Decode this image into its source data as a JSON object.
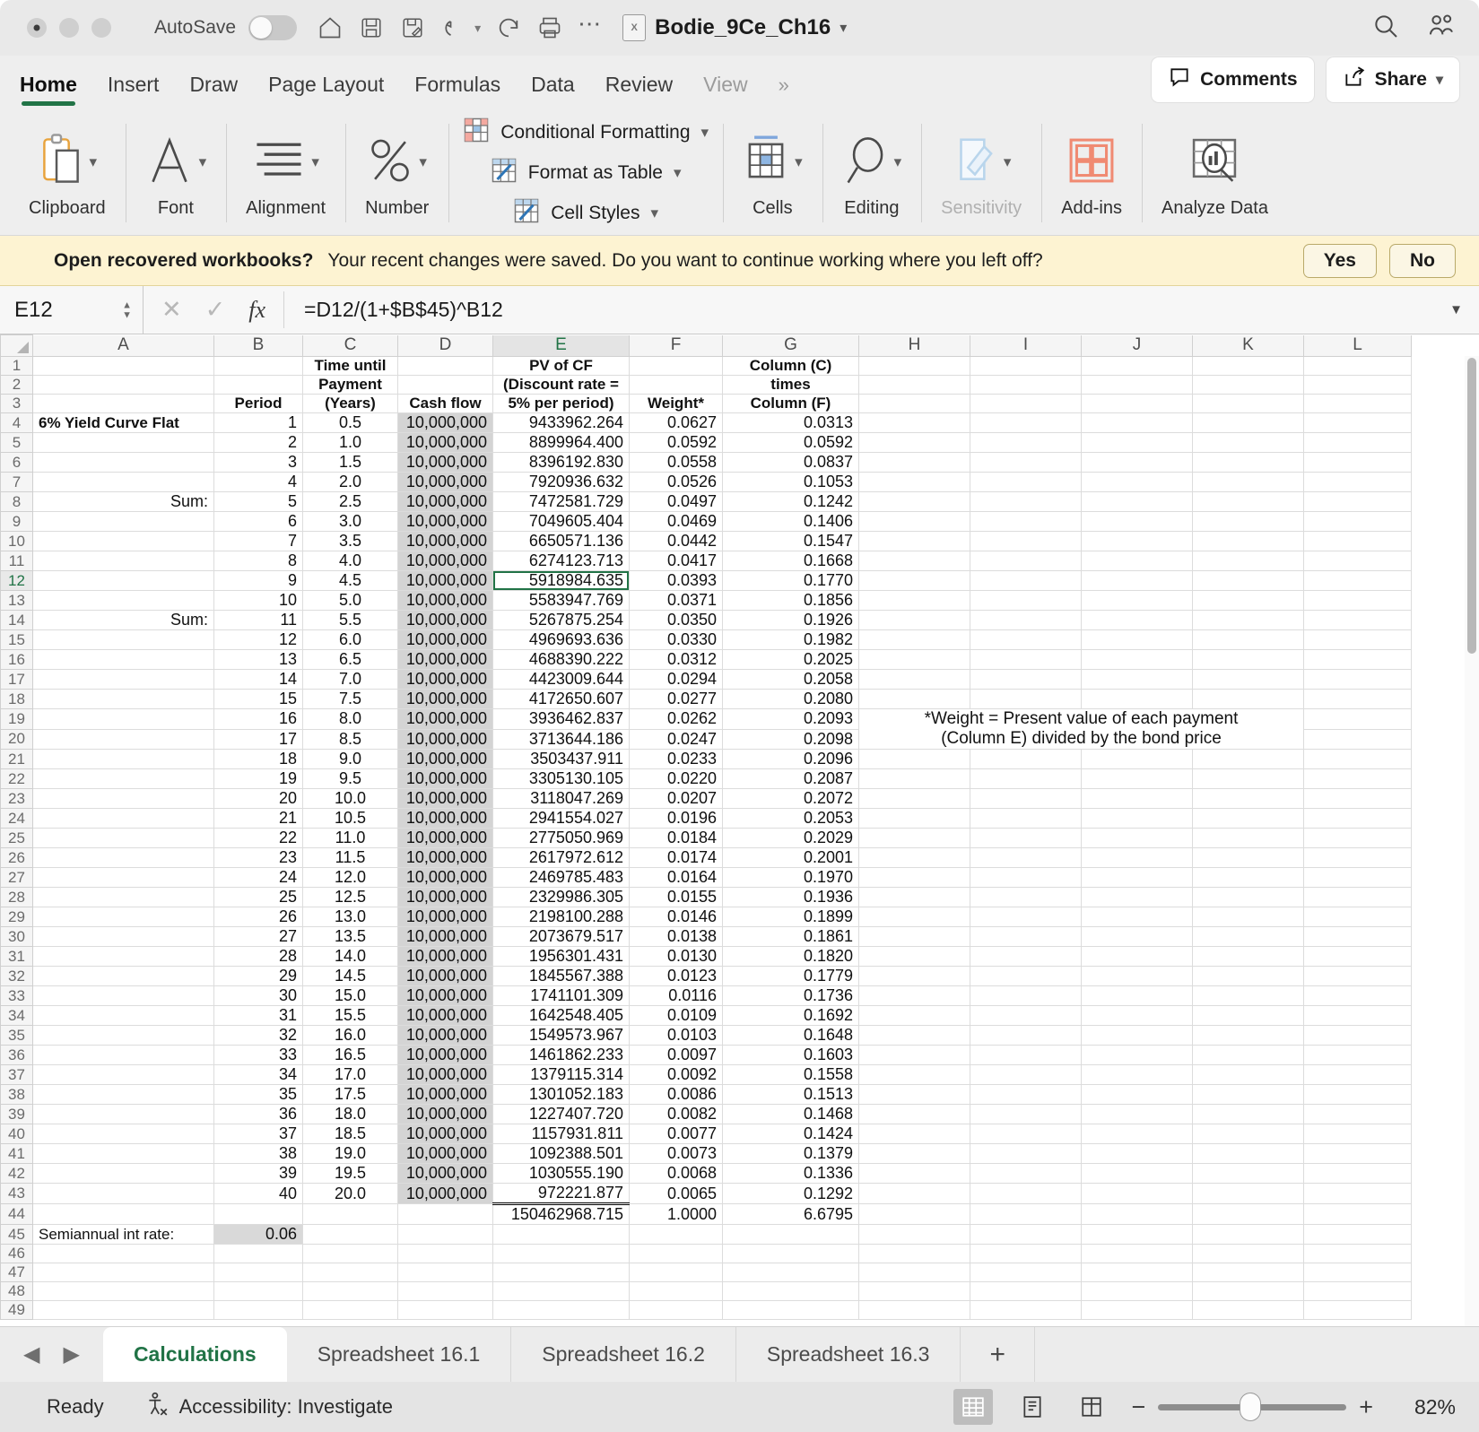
{
  "titlebar": {
    "autosave_label": "AutoSave",
    "autosave_state": "off",
    "doc_title": "Bodie_9Ce_Ch16",
    "icons": [
      "home-icon",
      "save-icon",
      "save-as-icon",
      "undo-icon",
      "redo-icon",
      "print-icon",
      "more-icon",
      "search-icon",
      "user-group-icon"
    ]
  },
  "ribbon_tabs": {
    "tabs": [
      "Home",
      "Insert",
      "Draw",
      "Page Layout",
      "Formulas",
      "Data",
      "Review",
      "View"
    ],
    "active": "Home",
    "overflow": "»",
    "comments_label": "Comments",
    "share_label": "Share"
  },
  "ribbon": {
    "groups": [
      {
        "label": "Clipboard",
        "icon": "clipboard-icon"
      },
      {
        "label": "Font",
        "icon": "font-icon"
      },
      {
        "label": "Alignment",
        "icon": "alignment-icon"
      },
      {
        "label": "Number",
        "icon": "percent-icon"
      }
    ],
    "styles_items": [
      {
        "label": "Conditional Formatting",
        "icon": "conditional-formatting-icon"
      },
      {
        "label": "Format as Table",
        "icon": "format-as-table-icon"
      },
      {
        "label": "Cell Styles",
        "icon": "cell-styles-icon"
      }
    ],
    "right_groups": [
      {
        "label": "Cells",
        "icon": "cells-icon",
        "dim": false
      },
      {
        "label": "Editing",
        "icon": "editing-icon",
        "dim": false
      },
      {
        "label": "Sensitivity",
        "icon": "sensitivity-icon",
        "dim": true
      },
      {
        "label": "Add-ins",
        "icon": "add-ins-icon",
        "dim": false
      },
      {
        "label": "Analyze Data",
        "icon": "analyze-data-icon",
        "dim": false
      }
    ]
  },
  "recovery_bar": {
    "title": "Open recovered workbooks?",
    "message": "Your recent changes were saved. Do you want to continue working where you left off?",
    "yes_label": "Yes",
    "no_label": "No"
  },
  "formula_bar": {
    "name_box": "E12",
    "cancel_icon": "cancel-icon",
    "confirm_icon": "confirm-icon",
    "fx_label": "fx",
    "formula": "=D12/(1+$B$45)^B12",
    "expand_icon": "chevron-down-icon"
  },
  "grid": {
    "column_headers": [
      "A",
      "B",
      "C",
      "D",
      "E",
      "F",
      "G",
      "H",
      "I",
      "J",
      "K",
      "L"
    ],
    "selected_column": "E",
    "selected_row": 12,
    "header_rows": [
      {
        "row": 1,
        "A": "",
        "B": "",
        "C": "Time until",
        "D": "",
        "E": "PV of CF",
        "F": "",
        "G": "Column (C)"
      },
      {
        "row": 2,
        "A": "",
        "B": "",
        "C": "Payment",
        "D": "",
        "E": "(Discount rate =",
        "F": "",
        "G": "times"
      },
      {
        "row": 3,
        "A": "",
        "B": "Period",
        "C": "(Years)",
        "D": "Cash flow",
        "E": "5% per period)",
        "F": "Weight*",
        "G": "Column (F)"
      }
    ],
    "label_cells": {
      "a4": "6% Yield Curve Flat",
      "b8_sum": "Sum:",
      "b14_sum": "Sum:",
      "a45": "Semiannual int rate:",
      "b45": "0.06"
    },
    "note": {
      "line1": "*Weight = Present value of each payment",
      "line2": "(Column E) divided by the bond price",
      "row_start": 19
    },
    "rows": [
      {
        "row": 4,
        "period": "1",
        "years": "0.5",
        "cash": "10,000,000",
        "pv": "9433962.264",
        "weight": "0.0627",
        "cf": "0.0313"
      },
      {
        "row": 5,
        "period": "2",
        "years": "1.0",
        "cash": "10,000,000",
        "pv": "8899964.400",
        "weight": "0.0592",
        "cf": "0.0592"
      },
      {
        "row": 6,
        "period": "3",
        "years": "1.5",
        "cash": "10,000,000",
        "pv": "8396192.830",
        "weight": "0.0558",
        "cf": "0.0837"
      },
      {
        "row": 7,
        "period": "4",
        "years": "2.0",
        "cash": "10,000,000",
        "pv": "7920936.632",
        "weight": "0.0526",
        "cf": "0.1053"
      },
      {
        "row": 8,
        "period": "5",
        "years": "2.5",
        "cash": "10,000,000",
        "pv": "7472581.729",
        "weight": "0.0497",
        "cf": "0.1242"
      },
      {
        "row": 9,
        "period": "6",
        "years": "3.0",
        "cash": "10,000,000",
        "pv": "7049605.404",
        "weight": "0.0469",
        "cf": "0.1406"
      },
      {
        "row": 10,
        "period": "7",
        "years": "3.5",
        "cash": "10,000,000",
        "pv": "6650571.136",
        "weight": "0.0442",
        "cf": "0.1547"
      },
      {
        "row": 11,
        "period": "8",
        "years": "4.0",
        "cash": "10,000,000",
        "pv": "6274123.713",
        "weight": "0.0417",
        "cf": "0.1668"
      },
      {
        "row": 12,
        "period": "9",
        "years": "4.5",
        "cash": "10,000,000",
        "pv": "5918984.635",
        "weight": "0.0393",
        "cf": "0.1770"
      },
      {
        "row": 13,
        "period": "10",
        "years": "5.0",
        "cash": "10,000,000",
        "pv": "5583947.769",
        "weight": "0.0371",
        "cf": "0.1856"
      },
      {
        "row": 14,
        "period": "11",
        "years": "5.5",
        "cash": "10,000,000",
        "pv": "5267875.254",
        "weight": "0.0350",
        "cf": "0.1926"
      },
      {
        "row": 15,
        "period": "12",
        "years": "6.0",
        "cash": "10,000,000",
        "pv": "4969693.636",
        "weight": "0.0330",
        "cf": "0.1982"
      },
      {
        "row": 16,
        "period": "13",
        "years": "6.5",
        "cash": "10,000,000",
        "pv": "4688390.222",
        "weight": "0.0312",
        "cf": "0.2025"
      },
      {
        "row": 17,
        "period": "14",
        "years": "7.0",
        "cash": "10,000,000",
        "pv": "4423009.644",
        "weight": "0.0294",
        "cf": "0.2058"
      },
      {
        "row": 18,
        "period": "15",
        "years": "7.5",
        "cash": "10,000,000",
        "pv": "4172650.607",
        "weight": "0.0277",
        "cf": "0.2080"
      },
      {
        "row": 19,
        "period": "16",
        "years": "8.0",
        "cash": "10,000,000",
        "pv": "3936462.837",
        "weight": "0.0262",
        "cf": "0.2093"
      },
      {
        "row": 20,
        "period": "17",
        "years": "8.5",
        "cash": "10,000,000",
        "pv": "3713644.186",
        "weight": "0.0247",
        "cf": "0.2098"
      },
      {
        "row": 21,
        "period": "18",
        "years": "9.0",
        "cash": "10,000,000",
        "pv": "3503437.911",
        "weight": "0.0233",
        "cf": "0.2096"
      },
      {
        "row": 22,
        "period": "19",
        "years": "9.5",
        "cash": "10,000,000",
        "pv": "3305130.105",
        "weight": "0.0220",
        "cf": "0.2087"
      },
      {
        "row": 23,
        "period": "20",
        "years": "10.0",
        "cash": "10,000,000",
        "pv": "3118047.269",
        "weight": "0.0207",
        "cf": "0.2072"
      },
      {
        "row": 24,
        "period": "21",
        "years": "10.5",
        "cash": "10,000,000",
        "pv": "2941554.027",
        "weight": "0.0196",
        "cf": "0.2053"
      },
      {
        "row": 25,
        "period": "22",
        "years": "11.0",
        "cash": "10,000,000",
        "pv": "2775050.969",
        "weight": "0.0184",
        "cf": "0.2029"
      },
      {
        "row": 26,
        "period": "23",
        "years": "11.5",
        "cash": "10,000,000",
        "pv": "2617972.612",
        "weight": "0.0174",
        "cf": "0.2001"
      },
      {
        "row": 27,
        "period": "24",
        "years": "12.0",
        "cash": "10,000,000",
        "pv": "2469785.483",
        "weight": "0.0164",
        "cf": "0.1970"
      },
      {
        "row": 28,
        "period": "25",
        "years": "12.5",
        "cash": "10,000,000",
        "pv": "2329986.305",
        "weight": "0.0155",
        "cf": "0.1936"
      },
      {
        "row": 29,
        "period": "26",
        "years": "13.0",
        "cash": "10,000,000",
        "pv": "2198100.288",
        "weight": "0.0146",
        "cf": "0.1899"
      },
      {
        "row": 30,
        "period": "27",
        "years": "13.5",
        "cash": "10,000,000",
        "pv": "2073679.517",
        "weight": "0.0138",
        "cf": "0.1861"
      },
      {
        "row": 31,
        "period": "28",
        "years": "14.0",
        "cash": "10,000,000",
        "pv": "1956301.431",
        "weight": "0.0130",
        "cf": "0.1820"
      },
      {
        "row": 32,
        "period": "29",
        "years": "14.5",
        "cash": "10,000,000",
        "pv": "1845567.388",
        "weight": "0.0123",
        "cf": "0.1779"
      },
      {
        "row": 33,
        "period": "30",
        "years": "15.0",
        "cash": "10,000,000",
        "pv": "1741101.309",
        "weight": "0.0116",
        "cf": "0.1736"
      },
      {
        "row": 34,
        "period": "31",
        "years": "15.5",
        "cash": "10,000,000",
        "pv": "1642548.405",
        "weight": "0.0109",
        "cf": "0.1692"
      },
      {
        "row": 35,
        "period": "32",
        "years": "16.0",
        "cash": "10,000,000",
        "pv": "1549573.967",
        "weight": "0.0103",
        "cf": "0.1648"
      },
      {
        "row": 36,
        "period": "33",
        "years": "16.5",
        "cash": "10,000,000",
        "pv": "1461862.233",
        "weight": "0.0097",
        "cf": "0.1603"
      },
      {
        "row": 37,
        "period": "34",
        "years": "17.0",
        "cash": "10,000,000",
        "pv": "1379115.314",
        "weight": "0.0092",
        "cf": "0.1558"
      },
      {
        "row": 38,
        "period": "35",
        "years": "17.5",
        "cash": "10,000,000",
        "pv": "1301052.183",
        "weight": "0.0086",
        "cf": "0.1513"
      },
      {
        "row": 39,
        "period": "36",
        "years": "18.0",
        "cash": "10,000,000",
        "pv": "1227407.720",
        "weight": "0.0082",
        "cf": "0.1468"
      },
      {
        "row": 40,
        "period": "37",
        "years": "18.5",
        "cash": "10,000,000",
        "pv": "1157931.811",
        "weight": "0.0077",
        "cf": "0.1424"
      },
      {
        "row": 41,
        "period": "38",
        "years": "19.0",
        "cash": "10,000,000",
        "pv": "1092388.501",
        "weight": "0.0073",
        "cf": "0.1379"
      },
      {
        "row": 42,
        "period": "39",
        "years": "19.5",
        "cash": "10,000,000",
        "pv": "1030555.190",
        "weight": "0.0068",
        "cf": "0.1336"
      },
      {
        "row": 43,
        "period": "40",
        "years": "20.0",
        "cash": "10,000,000",
        "pv": "972221.877",
        "weight": "0.0065",
        "cf": "0.1292"
      },
      {
        "row": 44,
        "period": "",
        "years": "",
        "cash": "",
        "pv": "150462968.715",
        "weight": "1.0000",
        "cf": "6.6795"
      }
    ],
    "empty_rows": [
      46,
      47,
      48,
      49
    ]
  },
  "sheet_tabs": {
    "prev_icon": "prev-sheet-icon",
    "next_icon": "next-sheet-icon",
    "tabs": [
      "Calculations",
      "Spreadsheet 16.1",
      "Spreadsheet 16.2",
      "Spreadsheet 16.3"
    ],
    "active": "Calculations",
    "add_label": "+"
  },
  "status_bar": {
    "ready": "Ready",
    "accessibility": "Accessibility: Investigate",
    "view_normal_icon": "normal-view-icon",
    "view_layout_icon": "page-layout-view-icon",
    "view_break_icon": "page-break-view-icon",
    "zoom_out": "−",
    "zoom_in": "+",
    "zoom_level": "82%"
  },
  "colors": {
    "accent_green": "#217346",
    "recovery_bg": "#fdf3d2",
    "shade_gray": "#d4d4d4"
  }
}
